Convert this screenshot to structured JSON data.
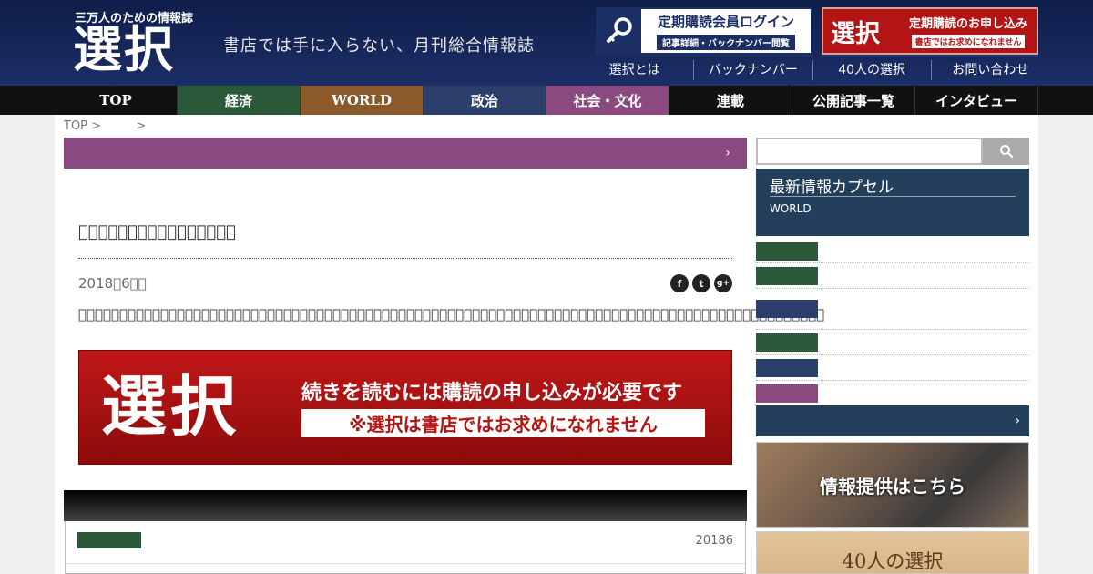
{
  "header": {
    "tagline": "三万人のための情報誌",
    "logo": "選択",
    "subtitle": "書店では手に入らない、月刊総合情報誌",
    "login": {
      "title": "定期購読会員ログイン",
      "sub": "記事詳細・バックナンバー閲覧",
      "icon": "key-icon"
    },
    "subscribe": {
      "logo": "選択",
      "title": "定期購読のお申し込み",
      "sub": "書店ではお求めになれません"
    },
    "links": [
      "選択とは",
      "バックナンバー",
      "40人の選択",
      "お問い合わせ"
    ]
  },
  "nav": [
    {
      "label": "TOP",
      "color": "#111111"
    },
    {
      "label": "経済",
      "color": "#2a5a3a"
    },
    {
      "label": "WORLD",
      "color": "#8b5a2b"
    },
    {
      "label": "政治",
      "color": "#2c3e6b"
    },
    {
      "label": "社会・文化",
      "color": "#8a4a80"
    },
    {
      "label": "連載",
      "color": "#111111"
    },
    {
      "label": "公開記事一覧",
      "color": "#111111"
    },
    {
      "label": "インタビュー",
      "color": "#111111"
    }
  ],
  "breadcrumb": {
    "top": "TOP",
    "sep1": ">",
    "sep2": ">"
  },
  "category_bar": {
    "chevron": "›"
  },
  "article": {
    "title": "￿￿￿￿￿￿￿￿￿￿￿￿￿￿￿￿",
    "date": "2018￿6￿￿",
    "body": "￿￿￿￿￿￿￿￿￿￿￿￿￿￿￿￿￿￿￿￿￿￿￿￿￿￿￿￿￿￿￿￿￿￿￿￿￿￿￿￿￿￿￿￿￿￿￿￿￿￿￿￿￿￿￿￿￿￿￿￿￿￿￿￿￿￿￿￿￿￿￿￿￿￿￿￿￿￿￿￿￿￿￿￿￿￿￿￿￿￿￿",
    "social": [
      "f",
      "t",
      "g+"
    ]
  },
  "promo": {
    "logo": "選択",
    "line1": "続きを読むには購読の申し込みが必要です",
    "line2": "※選択は書店ではお求めになれません"
  },
  "related": {
    "date": "20186",
    "tag_color": "#2a5a3a"
  },
  "sidebar": {
    "capsule_title": "最新情報カプセル",
    "capsule_category": "WORLD",
    "items": [
      {
        "color": "#2a5a3a"
      },
      {
        "color": "#2a5a3a"
      },
      {
        "color": "#2c3e6b"
      },
      {
        "color": "#2a5a3a"
      },
      {
        "color": "#2c3e6b"
      },
      {
        "color": "#8a4a80"
      }
    ],
    "banner_info": "情報提供はこちら",
    "banner_40": "40人の選択"
  }
}
